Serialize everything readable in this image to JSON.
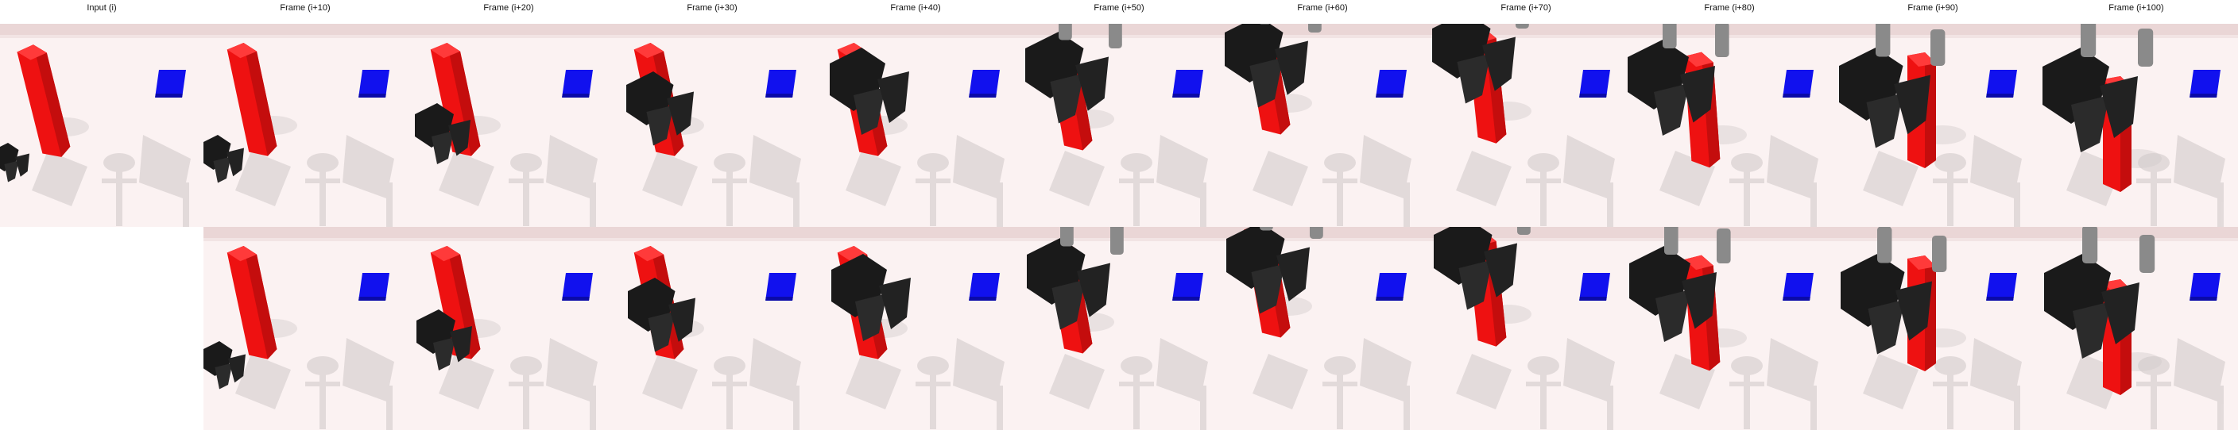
{
  "figure": {
    "columns": [
      {
        "title": "Input (i)"
      },
      {
        "title": "Frame (i+10)"
      },
      {
        "title": "Frame (i+20)"
      },
      {
        "title": "Frame (i+30)"
      },
      {
        "title": "Frame (i+40)"
      },
      {
        "title": "Frame (i+50)"
      },
      {
        "title": "Frame (i+60)"
      },
      {
        "title": "Frame (i+70)"
      },
      {
        "title": "Frame (i+80)"
      },
      {
        "title": "Frame (i+90)"
      },
      {
        "title": "Frame (i+100)"
      }
    ],
    "colors": {
      "background": "#fbf2f2",
      "wall": "#ead6d6",
      "red_block": "#ee1111",
      "blue_block": "#1111ee",
      "robot": "#1a1a1a",
      "gripper_finger": "#8a8a8a",
      "shadow": "#cfc8c8"
    }
  }
}
